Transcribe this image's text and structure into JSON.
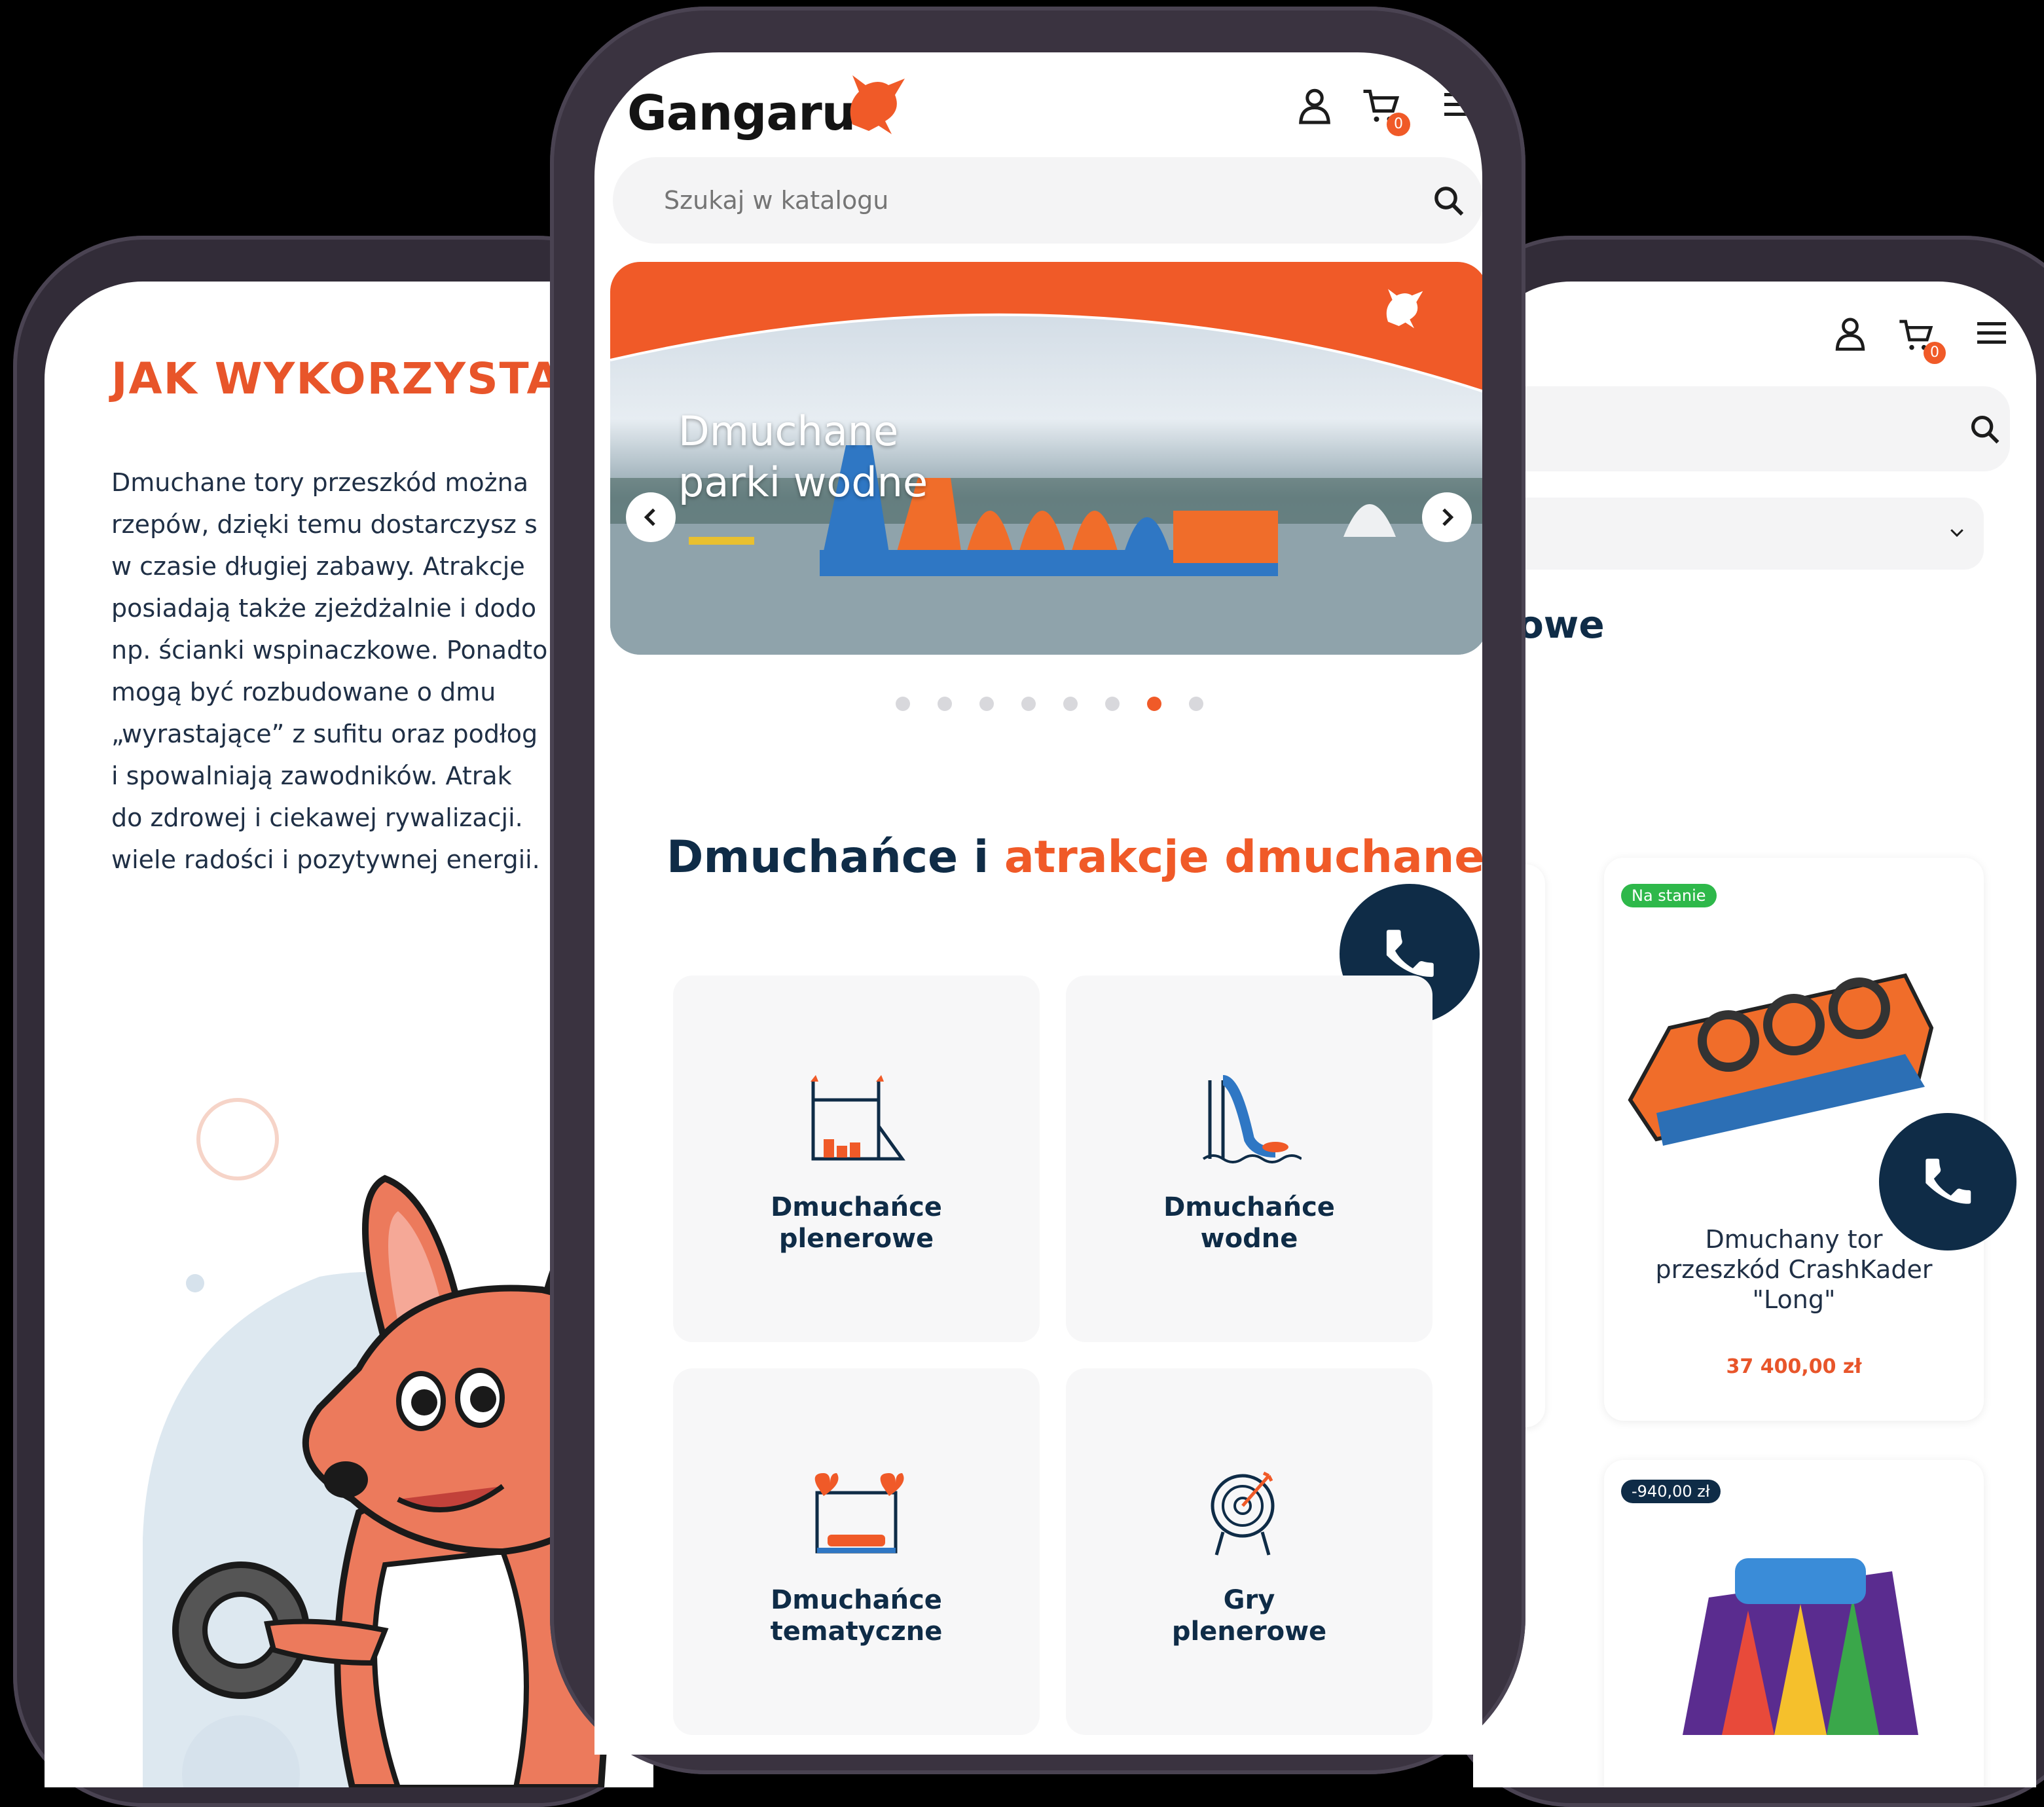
{
  "left_phone": {
    "heading": "JAK WYKORZYSTA",
    "body_lines": [
      "Dmuchane tory przeszkód można",
      "rzepów, dzięki temu dostarczysz s",
      "w czasie długiej zabawy. Atrakcje",
      "posiadają także zjeżdżalnie i dodo",
      "np. ścianki wspinaczkowe. Ponadto",
      "mogą być rozbudowane o dmu",
      "„wyrastające” z sufitu oraz podłog",
      "i spowalniają zawodników.  Atrak",
      "do zdrowej i ciekawej rywalizacji.",
      "wiele radości i pozytywnej energii."
    ]
  },
  "center_phone": {
    "brand": "Gangaru",
    "cart_count": "0",
    "search_placeholder": "Szukaj w katalogu",
    "banner_title_line1": "Dmuchane",
    "banner_title_line2": "parki wodne",
    "carousel_total": 8,
    "carousel_active": 7,
    "section_title_part1": "Dmuchańce i",
    "section_title_part2": "atrakcje dmuchane",
    "categories": [
      {
        "line1": "Dmuchańce",
        "line2": "plenerowe"
      },
      {
        "line1": "Dmuchańce",
        "line2": "wodne"
      },
      {
        "line1": "Dmuchańce",
        "line2": "tematyczne"
      },
      {
        "line1": "Gry",
        "line2": "plenerowe"
      }
    ],
    "colors": {
      "accent": "#f05a28",
      "navy": "#0f2c47",
      "card": "#f7f7f8"
    }
  },
  "right_phone": {
    "cart_count": "0",
    "heading_fragment": "erowe",
    "product": {
      "badge": "Na stanie",
      "name_line1": "Dmuchany tor",
      "name_line2": "przeszkód CrashKader",
      "name_line3": "\"Long\"",
      "price": "37 400,00 zł"
    },
    "second_badge": "-940,00 zł"
  }
}
